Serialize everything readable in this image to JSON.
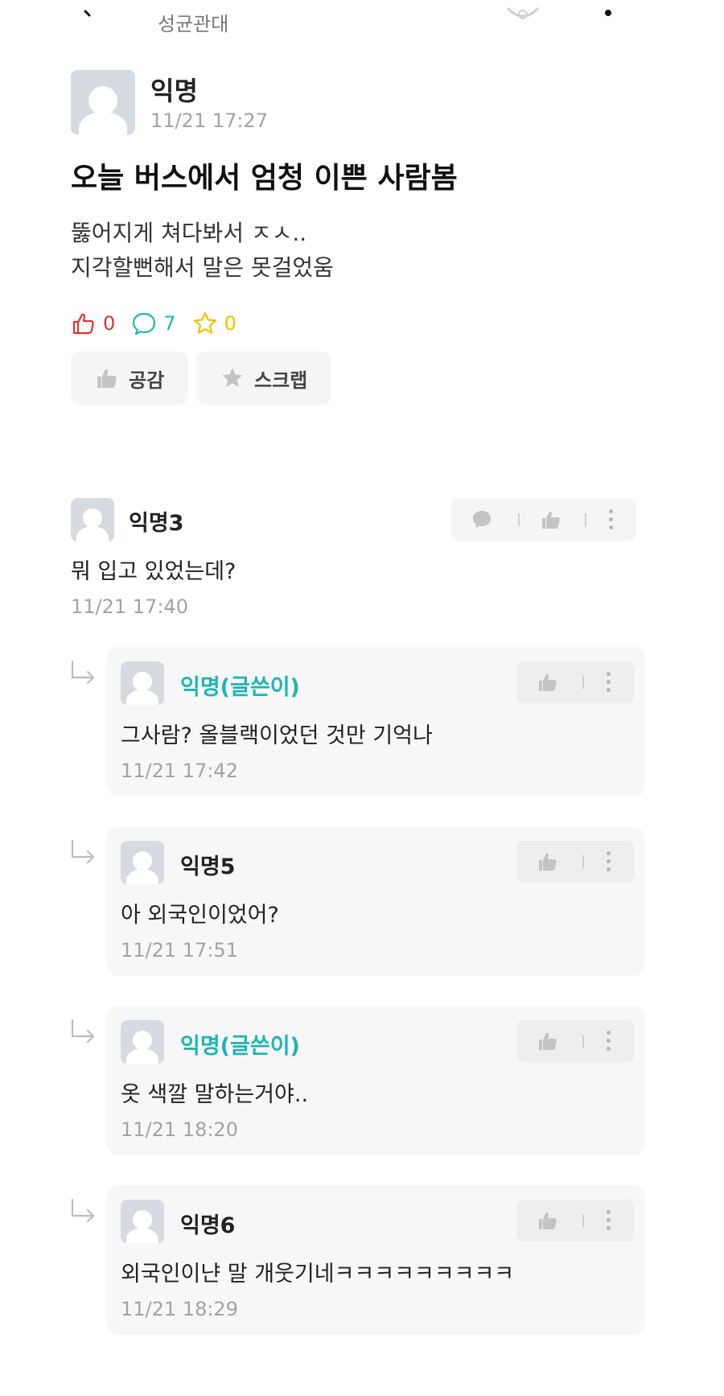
{
  "header": {
    "board_name": "성균관대"
  },
  "post": {
    "author": "익명",
    "time": "11/21 17:27",
    "title": "오늘 버스에서 엄청 이쁜 사람봄",
    "body_lines": [
      "뚫어지게 쳐다봐서 ㅈㅅ..",
      "지각할뻔해서 말은 못걸었움"
    ],
    "stats": {
      "likes": "0",
      "comments": "7",
      "scraps": "0"
    },
    "buttons": {
      "like_label": "공감",
      "scrap_label": "스크랩"
    }
  },
  "comments": [
    {
      "author": "익명3",
      "text": "뭐 입고 있었는데?",
      "time": "11/21 17:40",
      "is_reply": false,
      "is_op": false
    },
    {
      "author": "익명(글쓴이)",
      "text": "그사람? 올블랙이었던 것만 기억나",
      "time": "11/21 17:42",
      "is_reply": true,
      "is_op": true
    },
    {
      "author": "익명5",
      "text": "아 외국인이었어?",
      "time": "11/21 17:51",
      "is_reply": true,
      "is_op": false
    },
    {
      "author": "익명(글쓴이)",
      "text": "옷 색깔 말하는거야..",
      "time": "11/21 18:20",
      "is_reply": true,
      "is_op": true
    },
    {
      "author": "익명6",
      "text": "외국인이냔 말 개웃기네ㅋㅋㅋㅋㅋㅋㅋㅋㅋ",
      "time": "11/21 18:29",
      "is_reply": true,
      "is_op": false
    }
  ],
  "colors": {
    "like": "#e0342f",
    "comment": "#1fb5b3",
    "scrap": "#f2c200",
    "op_name": "#1fb5b3"
  },
  "icons": [
    "back-icon",
    "thumbs-up-icon",
    "speech-bubble-icon",
    "star-icon",
    "reply-arrow-icon",
    "more-vertical-icon"
  ]
}
